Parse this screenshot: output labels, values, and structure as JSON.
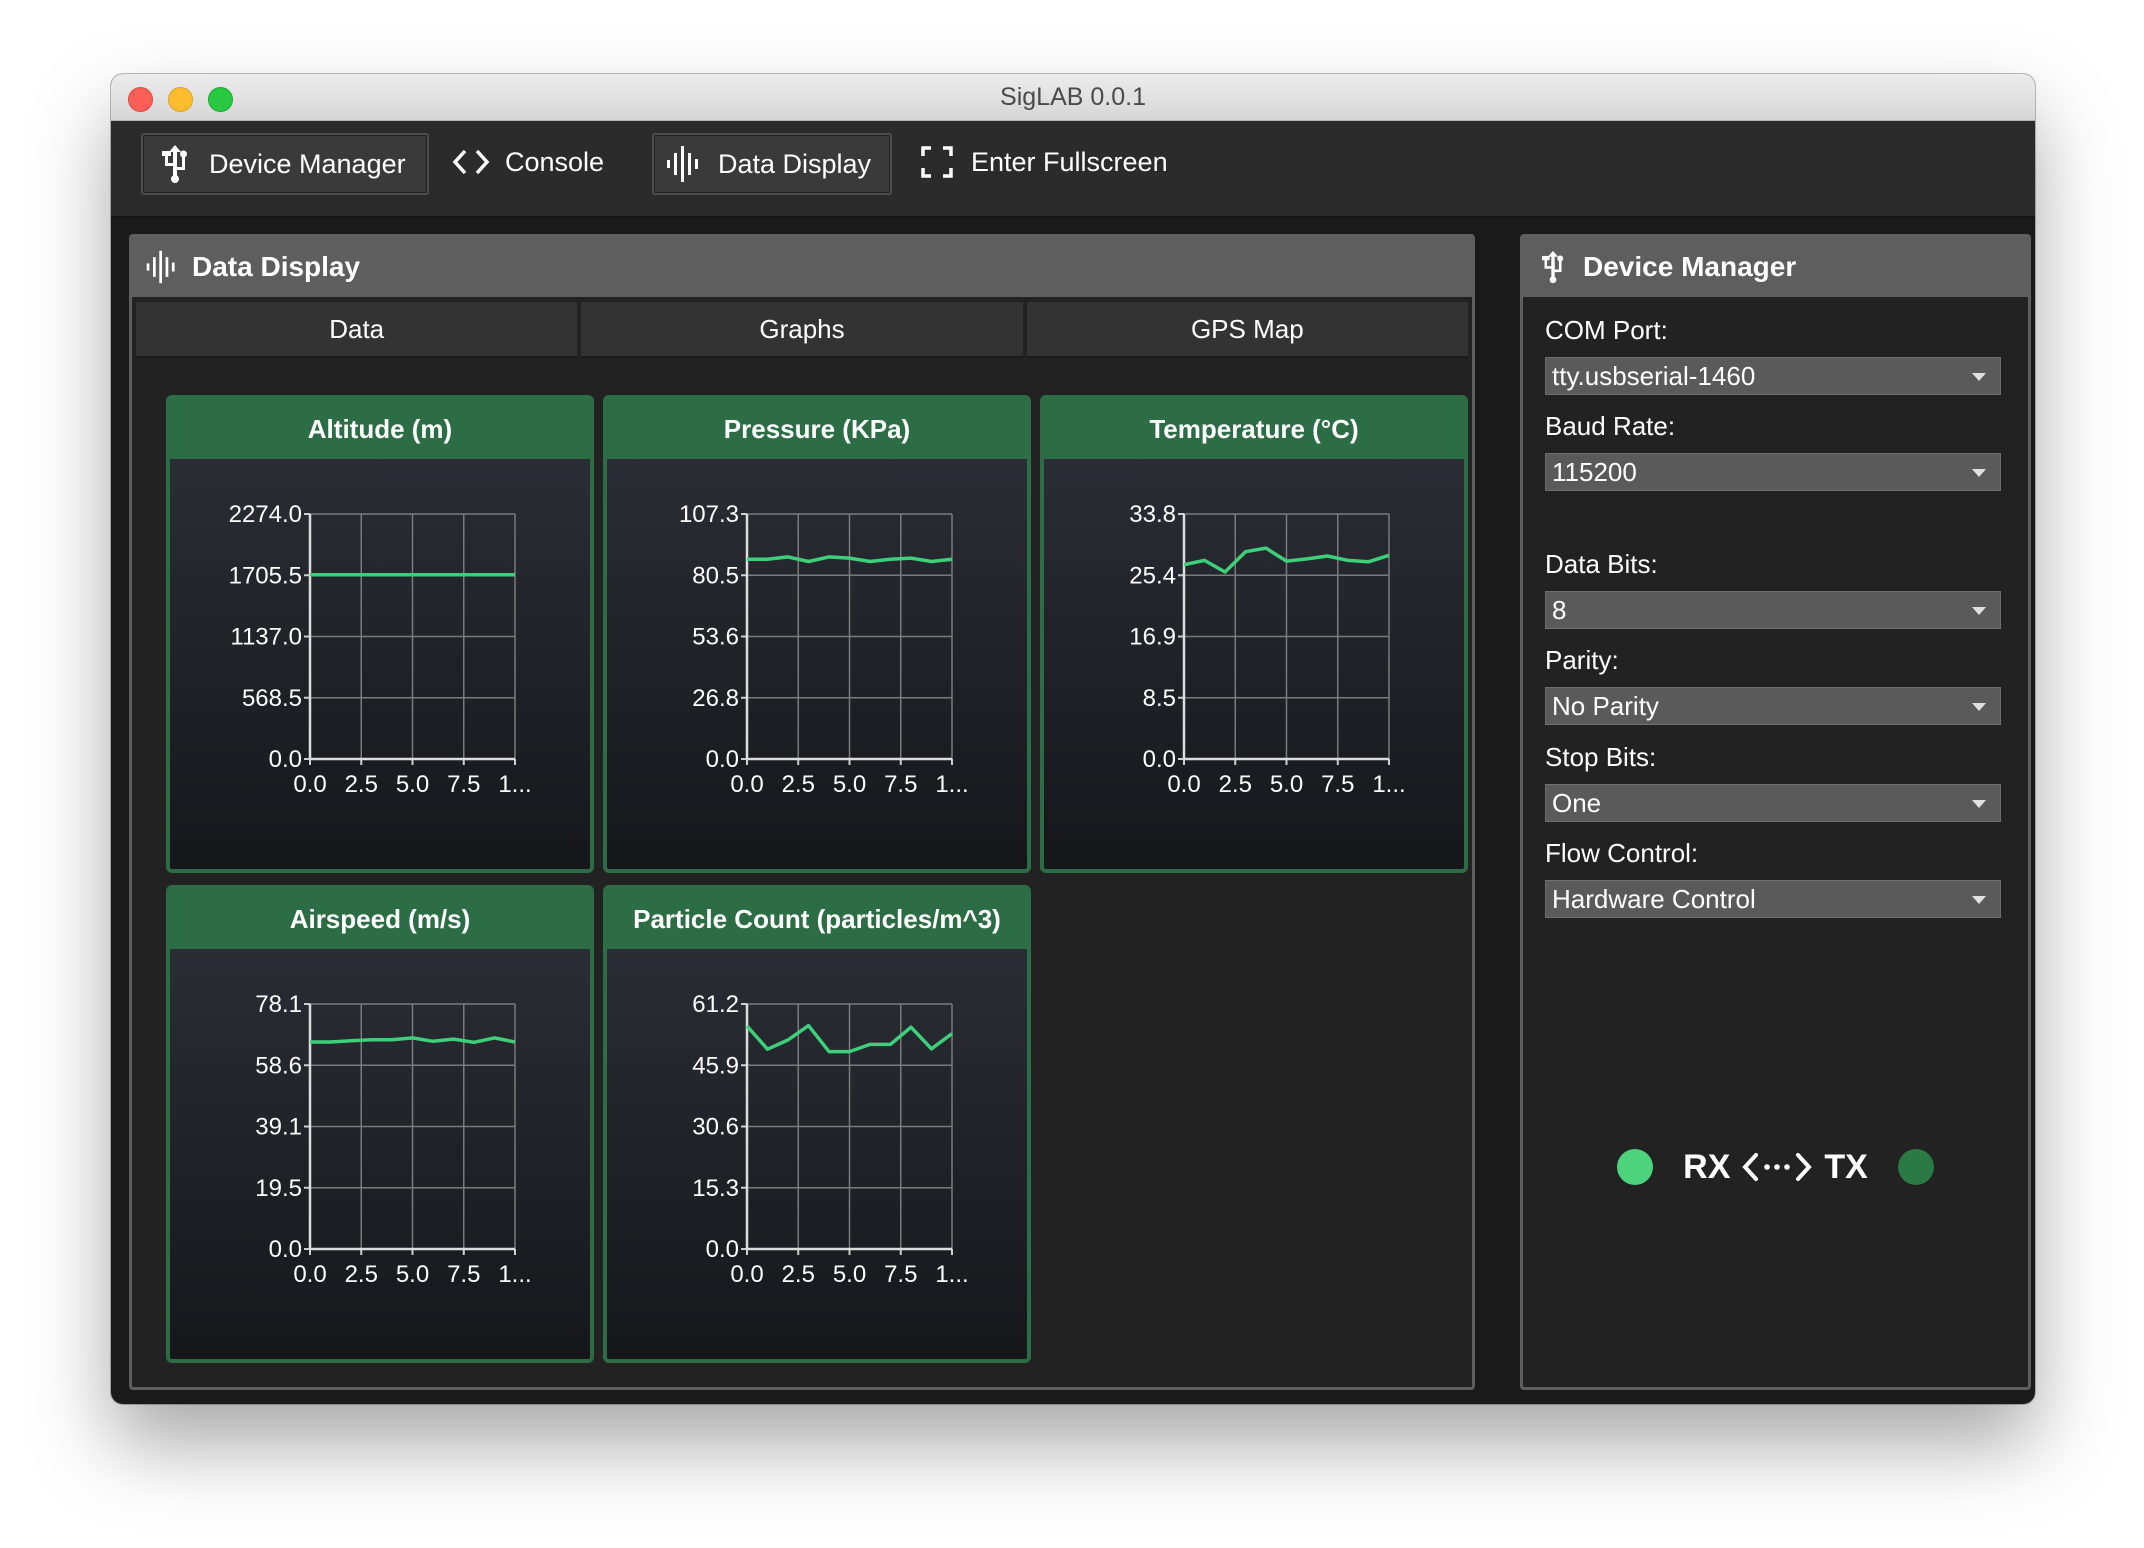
{
  "window": {
    "title": "SigLAB 0.0.1"
  },
  "toolbar": {
    "device_manager": "Device Manager",
    "console": "Console",
    "data_display": "Data Display",
    "fullscreen": "Enter Fullscreen"
  },
  "data_panel": {
    "title": "Data Display",
    "tabs": [
      "Data",
      "Graphs",
      "GPS Map"
    ]
  },
  "device_panel": {
    "title": "Device Manager",
    "com_port_label": "COM Port:",
    "com_port_value": "tty.usbserial-1460",
    "baud_label": "Baud Rate:",
    "baud_value": "115200",
    "databits_label": "Data Bits:",
    "databits_value": "8",
    "parity_label": "Parity:",
    "parity_value": "No Parity",
    "stopbits_label": "Stop Bits:",
    "stopbits_value": "One",
    "flow_label": "Flow Control:",
    "flow_value": "Hardware Control",
    "rx_label": "RX",
    "tx_label": "TX",
    "rx_color": "#4cd37b",
    "tx_color": "#2b7a46"
  },
  "icons": {
    "device_manager": "usb-icon",
    "console": "code-icon",
    "data_display": "waveform-icon",
    "fullscreen": "fullscreen-icon"
  },
  "colors": {
    "accent": "#2d6d45",
    "line": "#3ecf7a"
  },
  "chart_data": [
    {
      "type": "line",
      "title": "Altitude (m)",
      "x_ticks": [
        "0.0",
        "2.5",
        "5.0",
        "7.5",
        "1..."
      ],
      "y_ticks": [
        "2274.0",
        "1705.5",
        "1137.0",
        "568.5",
        "0.0"
      ],
      "ylim": [
        0,
        2274.0
      ],
      "xlim": [
        0,
        10
      ],
      "x": [
        0,
        1,
        2,
        3,
        4,
        5,
        6,
        7,
        8,
        9,
        10
      ],
      "y": [
        1710,
        1710,
        1710,
        1710,
        1710,
        1710,
        1710,
        1710,
        1710,
        1710,
        1710
      ]
    },
    {
      "type": "line",
      "title": "Pressure (KPa)",
      "x_ticks": [
        "0.0",
        "2.5",
        "5.0",
        "7.5",
        "1..."
      ],
      "y_ticks": [
        "107.3",
        "80.5",
        "53.6",
        "26.8",
        "0.0"
      ],
      "ylim": [
        0,
        107.3
      ],
      "xlim": [
        0,
        10
      ],
      "x": [
        0,
        1,
        2,
        3,
        4,
        5,
        6,
        7,
        8,
        9,
        10
      ],
      "y": [
        87.5,
        87.5,
        88.5,
        86.5,
        88.5,
        88.0,
        86.5,
        87.5,
        88.0,
        86.5,
        87.5
      ]
    },
    {
      "type": "line",
      "title": "Temperature (°C)",
      "x_ticks": [
        "0.0",
        "2.5",
        "5.0",
        "7.5",
        "1..."
      ],
      "y_ticks": [
        "33.8",
        "25.4",
        "16.9",
        "8.5",
        "0.0"
      ],
      "ylim": [
        0,
        33.8
      ],
      "xlim": [
        0,
        10
      ],
      "x": [
        0,
        1,
        2,
        3,
        4,
        5,
        6,
        7,
        8,
        9,
        10
      ],
      "y": [
        26.8,
        27.4,
        25.8,
        28.6,
        29.1,
        27.3,
        27.6,
        28.0,
        27.4,
        27.2,
        28.1
      ]
    },
    {
      "type": "line",
      "title": "Airspeed (m/s)",
      "x_ticks": [
        "0.0",
        "2.5",
        "5.0",
        "7.5",
        "1..."
      ],
      "y_ticks": [
        "78.1",
        "58.6",
        "39.1",
        "19.5",
        "0.0"
      ],
      "ylim": [
        0,
        78.1
      ],
      "xlim": [
        0,
        10
      ],
      "x": [
        0,
        1,
        2,
        3,
        4,
        5,
        6,
        7,
        8,
        9,
        10
      ],
      "y": [
        66.0,
        66.0,
        66.4,
        66.7,
        66.7,
        67.3,
        66.2,
        66.9,
        65.9,
        67.3,
        66.0
      ]
    },
    {
      "type": "line",
      "title": "Particle Count (particles/m^3)",
      "x_ticks": [
        "0.0",
        "2.5",
        "5.0",
        "7.5",
        "1..."
      ],
      "y_ticks": [
        "61.2",
        "45.9",
        "30.6",
        "15.3",
        "0.0"
      ],
      "ylim": [
        0,
        61.2
      ],
      "xlim": [
        0,
        10
      ],
      "x": [
        0,
        1,
        2,
        3,
        4,
        5,
        6,
        7,
        8,
        9,
        10
      ],
      "y": [
        55.7,
        49.9,
        52.2,
        55.8,
        49.3,
        49.3,
        51.1,
        51.1,
        55.4,
        50.0,
        53.8
      ]
    }
  ]
}
